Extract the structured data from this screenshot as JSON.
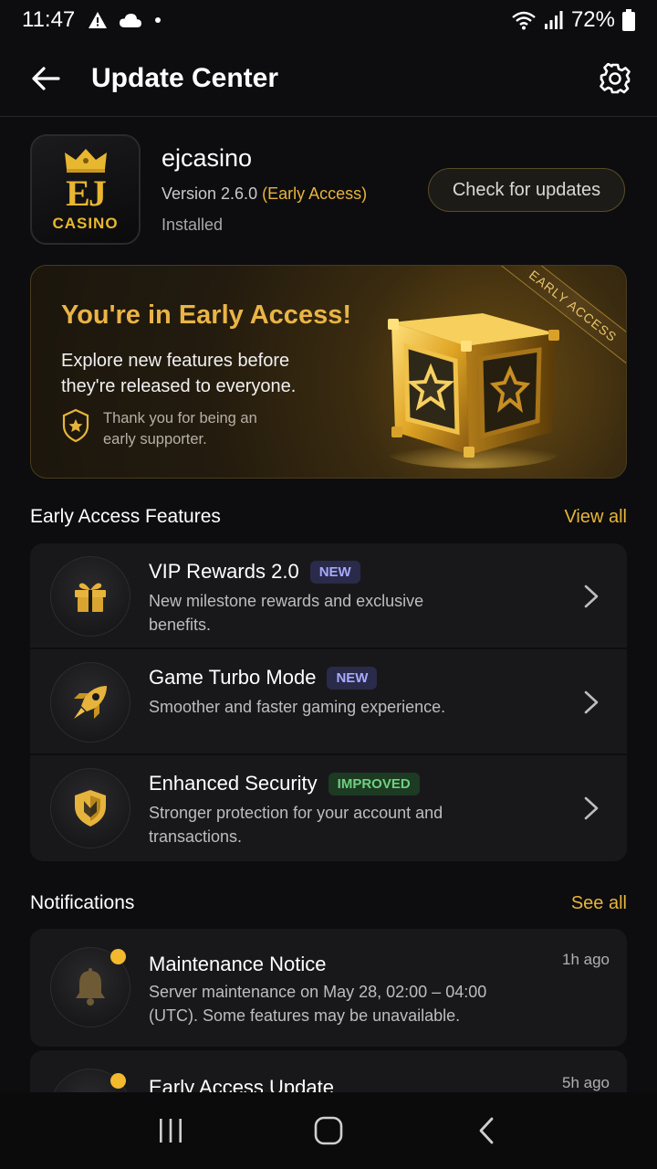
{
  "status_bar": {
    "time": "11:47",
    "battery": "72%",
    "icons": [
      "warning-icon",
      "cloud-icon",
      "dot-icon",
      "wifi-icon",
      "signal-icon",
      "battery-icon"
    ]
  },
  "app_bar": {
    "title": "Update Center",
    "back_icon": "arrow-left-icon",
    "settings_icon": "gear-icon"
  },
  "app_info": {
    "logo_initials": "EJ",
    "logo_text": "CASINO",
    "name": "ejcasino",
    "version_prefix": "Version 2.6.0",
    "version_tag": "(Early Access)",
    "status": "Installed",
    "check_button": "Check for updates"
  },
  "banner": {
    "title": "You're in Early Access!",
    "description": "Explore new features before they're released to everyone.",
    "thanks": "Thank you for being an early supporter.",
    "ribbon": "EARLY ACCESS"
  },
  "features_section": {
    "title": "Early Access Features",
    "link": "View all",
    "items": [
      {
        "title": "VIP Rewards 2.0",
        "badge": "NEW",
        "description": "New milestone rewards and exclusive benefits.",
        "icon": "gift-icon"
      },
      {
        "title": "Game Turbo Mode",
        "badge": "NEW",
        "description": "Smoother and faster gaming experience.",
        "icon": "rocket-icon"
      },
      {
        "title": "Enhanced Security",
        "badge": "IMPROVED",
        "description": "Stronger protection for your account and transactions.",
        "icon": "shield-icon"
      }
    ]
  },
  "notifications_section": {
    "title": "Notifications",
    "link": "See all",
    "items": [
      {
        "title": "Maintenance Notice",
        "body": "Server maintenance on May 28, 02:00 – 04:00 (UTC). Some features may be unavailable.",
        "time": "1h ago",
        "icon": "bell-icon"
      },
      {
        "title": "Early Access Update",
        "body": "",
        "time": "5h ago",
        "icon": "bell-icon"
      }
    ]
  },
  "nav_bar": {
    "items": [
      "recent-apps-icon",
      "home-icon",
      "back-icon"
    ]
  },
  "colors": {
    "accent_gold": "#e6b43c",
    "background": "#0d0d0f",
    "card": "#18181b",
    "badge_new_text": "#a7a9ff",
    "badge_improved_text": "#6fd07f"
  }
}
